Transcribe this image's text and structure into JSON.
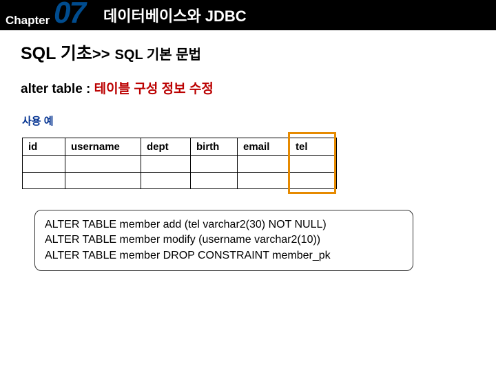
{
  "header": {
    "chapter_label": "Chapter",
    "chapter_number": "07",
    "title": "데이터베이스와 JDBC"
  },
  "section": {
    "title_main": "SQL 기초",
    "title_arrows": ">>",
    "title_sub": "SQL 기본 문법"
  },
  "subheading": {
    "cmd": "alter table",
    "sep": "  :",
    "desc": " 테이블 구성 정보 수정"
  },
  "usage_label": "사용 예",
  "columns": {
    "id": "id",
    "username": "username",
    "dept": "dept",
    "birth": "birth",
    "email": "email",
    "tel": "tel"
  },
  "code": {
    "line1": "ALTER TABLE member add (tel varchar2(30) NOT NULL)",
    "line2": "ALTER TABLE member modify (username varchar2(10))",
    "line3": "ALTER TABLE member DROP CONSTRAINT member_pk"
  }
}
